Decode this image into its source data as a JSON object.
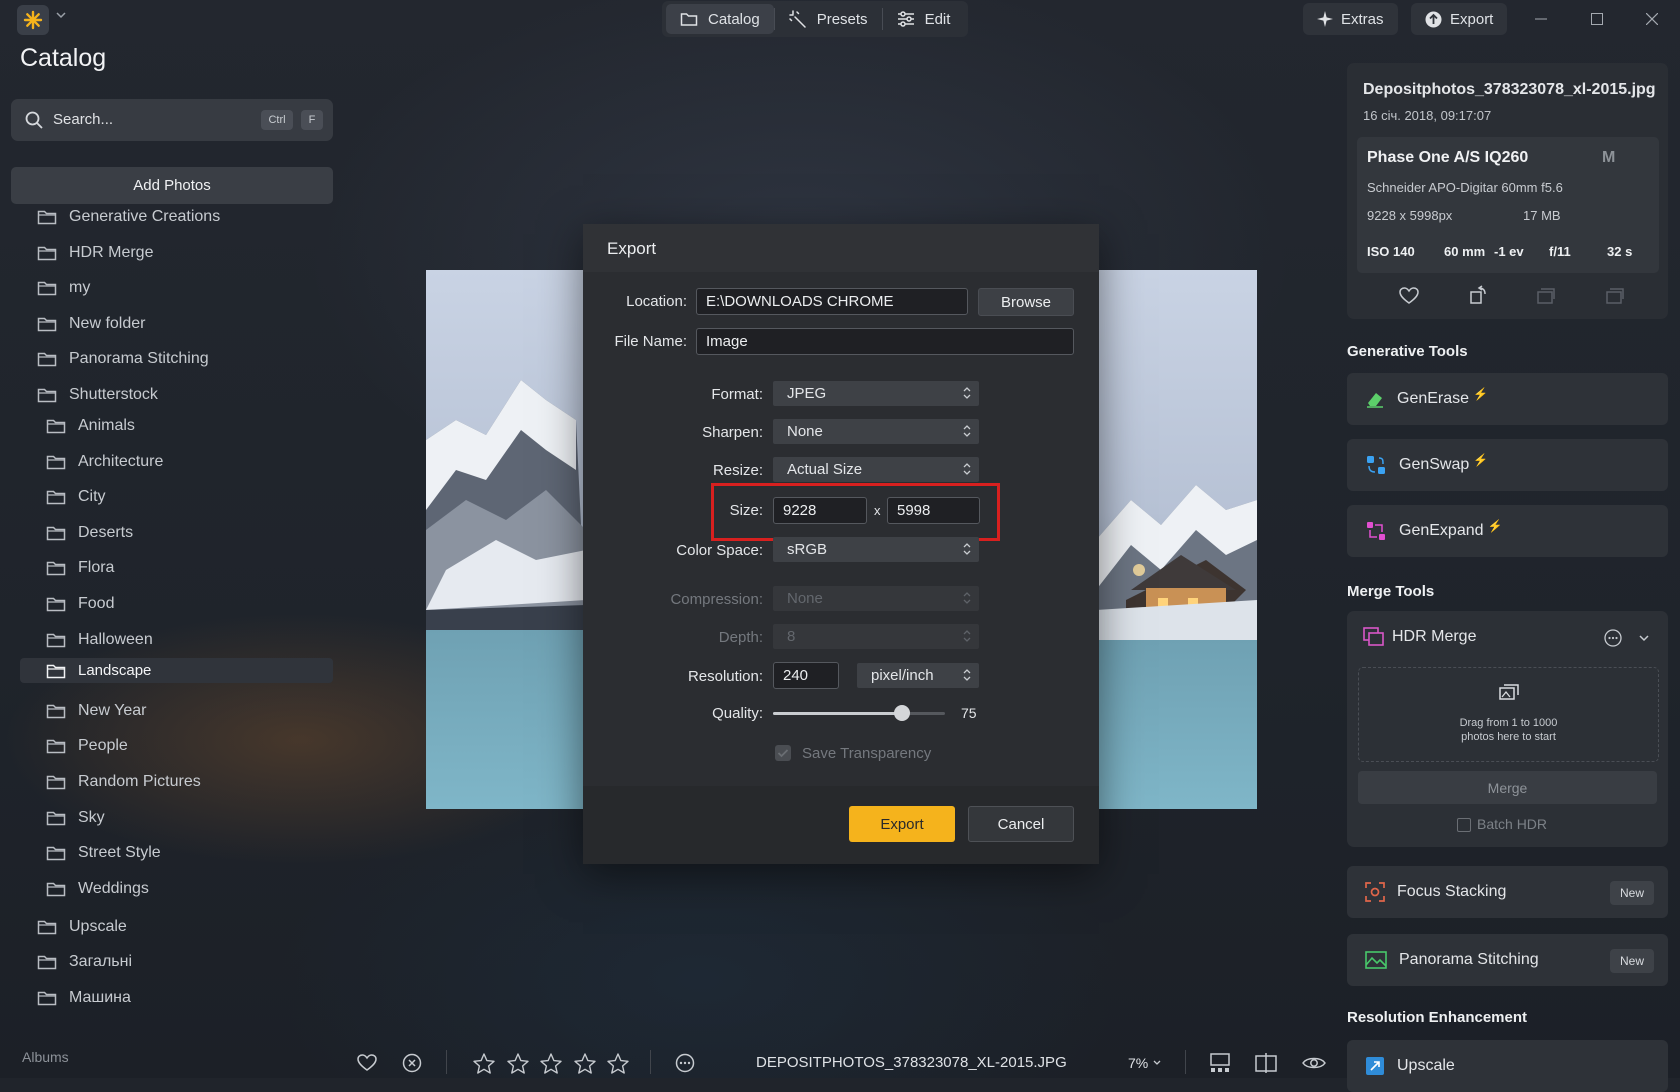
{
  "topbar": {
    "nav": [
      {
        "label": "Catalog",
        "active": true,
        "icon": "folder-icon"
      },
      {
        "label": "Presets",
        "active": false,
        "icon": "magic-wand-icon"
      },
      {
        "label": "Edit",
        "active": false,
        "icon": "sliders-icon"
      }
    ],
    "extras_label": "Extras",
    "export_label": "Export"
  },
  "sidebar": {
    "title": "Catalog",
    "search_placeholder": "Search...",
    "shortcut_ctrl": "Ctrl",
    "shortcut_key": "F",
    "add_photos_label": "Add Photos",
    "folders": [
      {
        "label": "Generative Creations",
        "level": 0
      },
      {
        "label": "HDR Merge",
        "level": 0
      },
      {
        "label": "my",
        "level": 0
      },
      {
        "label": "New folder",
        "level": 0
      },
      {
        "label": "Panorama Stitching",
        "level": 0
      },
      {
        "label": "Shutterstock",
        "level": 0
      },
      {
        "label": "Animals",
        "level": 1
      },
      {
        "label": "Architecture",
        "level": 1
      },
      {
        "label": "City",
        "level": 1
      },
      {
        "label": "Deserts",
        "level": 1
      },
      {
        "label": "Flora",
        "level": 1
      },
      {
        "label": "Food",
        "level": 1
      },
      {
        "label": "Halloween",
        "level": 1
      },
      {
        "label": "Landscape",
        "level": 1,
        "selected": true
      },
      {
        "label": "New Year",
        "level": 1
      },
      {
        "label": "People",
        "level": 1
      },
      {
        "label": "Random Pictures",
        "level": 1
      },
      {
        "label": "Sky",
        "level": 1
      },
      {
        "label": "Street Style",
        "level": 1
      },
      {
        "label": "Weddings",
        "level": 1
      },
      {
        "label": "Upscale",
        "level": 0
      },
      {
        "label": "Загальні",
        "level": 0
      },
      {
        "label": "Машина",
        "level": 0
      }
    ],
    "albums_label": "Albums"
  },
  "export_dialog": {
    "title": "Export",
    "location_label": "Location:",
    "location_value": "E:\\DOWNLOADS CHROME",
    "browse_label": "Browse",
    "filename_label": "File Name:",
    "filename_value": "Image",
    "format_label": "Format:",
    "format_value": "JPEG",
    "sharpen_label": "Sharpen:",
    "sharpen_value": "None",
    "resize_label": "Resize:",
    "resize_value": "Actual Size",
    "size_label": "Size:",
    "size_width": "9228",
    "size_sep": "x",
    "size_height": "5998",
    "colorspace_label": "Color Space:",
    "colorspace_value": "sRGB",
    "compression_label": "Compression:",
    "compression_value": "None",
    "depth_label": "Depth:",
    "depth_value": "8",
    "resolution_label": "Resolution:",
    "resolution_value": "240",
    "resolution_unit": "pixel/inch",
    "quality_label": "Quality:",
    "quality_value": "75",
    "quality_fraction": 0.75,
    "save_transparency_label": "Save Transparency",
    "export_button": "Export",
    "cancel_button": "Cancel"
  },
  "info_panel": {
    "filename": "Depositphotos_378323078_xl-2015.jpg",
    "date": "16 січ. 2018, 09:17:07",
    "camera": "Phase One A/S IQ260",
    "mode": "M",
    "lens": "Schneider APO-Digitar 60mm f5.6",
    "dimensions": "9228 x 5998px",
    "filesize": "17 MB",
    "iso": "ISO 140",
    "focal": "60 mm",
    "ev": "-1 ev",
    "aperture": "f/11",
    "shutter": "32 s"
  },
  "generative_tools": {
    "title": "Generative Tools",
    "items": [
      {
        "label": "GenErase",
        "color": "#5ccf6a"
      },
      {
        "label": "GenSwap",
        "color": "#3aa2f2"
      },
      {
        "label": "GenExpand",
        "color": "#e14fd0"
      }
    ]
  },
  "merge_tools": {
    "title": "Merge Tools",
    "hdr_label": "HDR Merge",
    "drop_text_1": "Drag from 1 to 1000",
    "drop_text_2": "photos here to start",
    "merge_button": "Merge",
    "batch_label": "Batch HDR",
    "focus_label": "Focus Stacking",
    "focus_badge": "New",
    "panorama_label": "Panorama Stitching",
    "panorama_badge": "New"
  },
  "resolution_enhancement": {
    "title": "Resolution Enhancement",
    "upscale_label": "Upscale"
  },
  "bottombar": {
    "filename": "DEPOSITPHOTOS_378323078_XL-2015.JPG",
    "zoom": "7%",
    "rating": 0
  },
  "colors": {
    "accent": "#f5b31c",
    "highlight": "#d8201f"
  }
}
